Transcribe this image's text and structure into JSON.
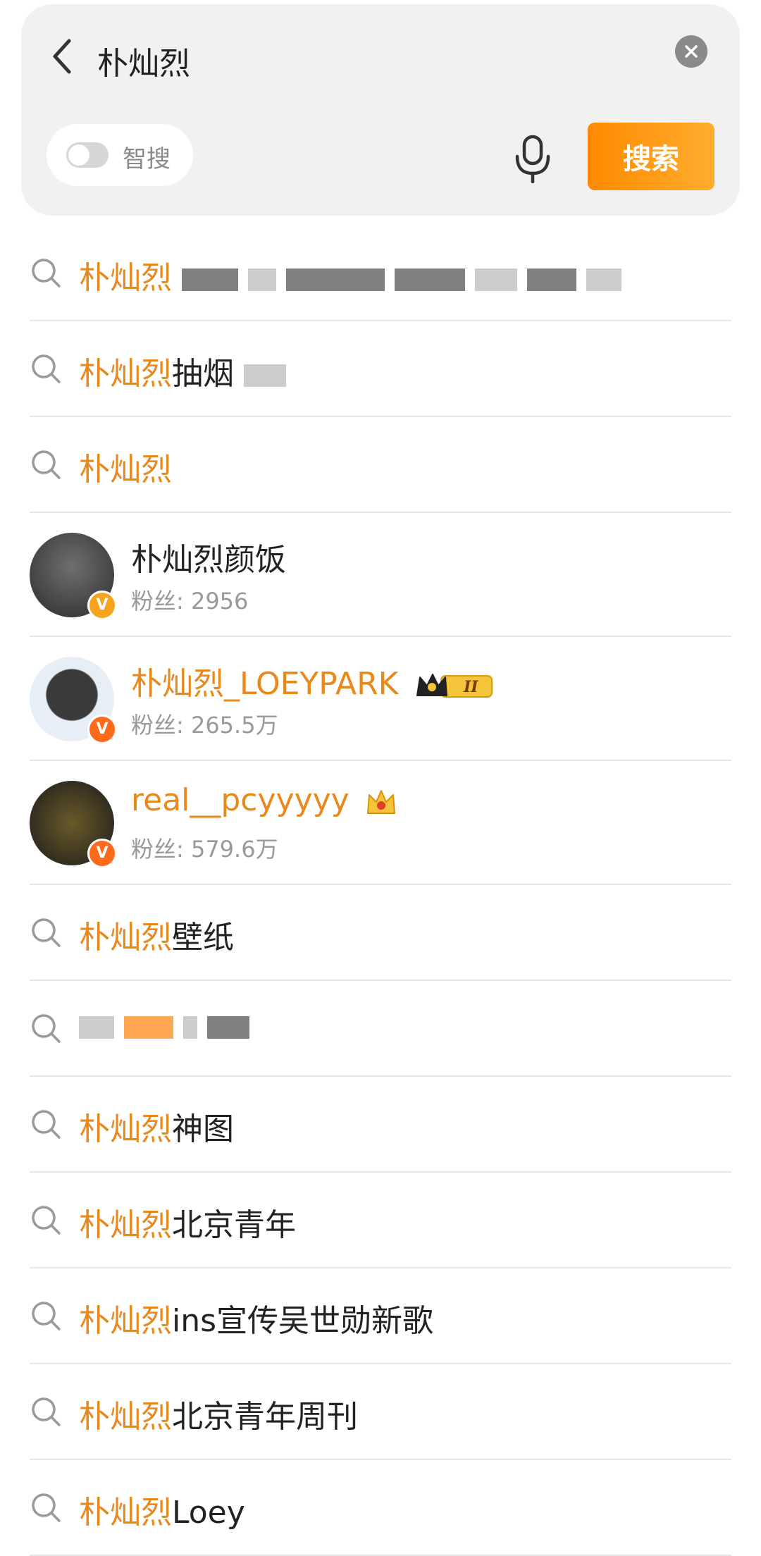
{
  "search": {
    "query": "朴灿烈",
    "smart_label": "智搜",
    "button_label": "搜索"
  },
  "colors": {
    "accent": "#e8891c",
    "button": "#ff8a00"
  },
  "suggestions_top": [
    {
      "highlight": "朴灿烈",
      "rest": ""
    },
    {
      "highlight": "朴灿烈",
      "rest": "抽烟"
    },
    {
      "highlight": "朴灿烈",
      "rest": ""
    }
  ],
  "users": [
    {
      "name": "朴灿烈颜饭",
      "fans": "粉丝: 2956",
      "highlight_name": false
    },
    {
      "name": "朴灿烈_LOEYPARK",
      "fans": "粉丝: 265.5万",
      "highlight_name": true
    },
    {
      "name": "real__pcyyyyy",
      "fans": "粉丝: 579.6万",
      "highlight_name": true
    }
  ],
  "suggestions_bottom": [
    {
      "highlight": "朴灿烈",
      "rest": "壁纸"
    },
    {
      "highlight": "",
      "rest": ""
    },
    {
      "highlight": "朴灿烈",
      "rest": "神图"
    },
    {
      "highlight": "朴灿烈",
      "rest": "北京青年"
    },
    {
      "highlight": "朴灿烈",
      "rest": "ins宣传吴世勋新歌"
    },
    {
      "highlight": "朴灿烈",
      "rest": "北京青年周刊"
    },
    {
      "highlight": "朴灿烈",
      "rest": "Loey"
    }
  ]
}
